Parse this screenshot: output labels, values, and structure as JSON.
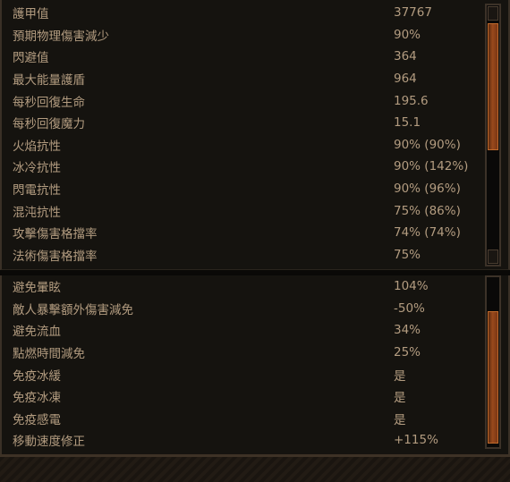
{
  "stats_top": [
    {
      "label": "護甲值",
      "value": "37767"
    },
    {
      "label": "預期物理傷害減少",
      "value": "90%"
    },
    {
      "label": "閃避值",
      "value": "364"
    },
    {
      "label": "最大能量護盾",
      "value": "964"
    },
    {
      "label": "每秒回復生命",
      "value": "195.6"
    },
    {
      "label": "每秒回復魔力",
      "value": "15.1"
    },
    {
      "label": "火焰抗性",
      "value": "90% (90%)"
    },
    {
      "label": "冰冷抗性",
      "value": "90% (142%)"
    },
    {
      "label": "閃電抗性",
      "value": "90% (96%)"
    },
    {
      "label": "混沌抗性",
      "value": "75% (86%)"
    },
    {
      "label": "攻擊傷害格擋率",
      "value": "74% (74%)"
    },
    {
      "label": "法術傷害格擋率",
      "value": "75%"
    }
  ],
  "stats_bottom": [
    {
      "label": "避免暈眩",
      "value": "104%"
    },
    {
      "label": "敵人暴擊額外傷害減免",
      "value": "-50%"
    },
    {
      "label": "避免流血",
      "value": "34%"
    },
    {
      "label": "點燃時間減免",
      "value": "25%"
    },
    {
      "label": "免疫冰緩",
      "value": "是"
    },
    {
      "label": "免疫冰凍",
      "value": "是"
    },
    {
      "label": "免疫感電",
      "value": "是"
    },
    {
      "label": "移動速度修正",
      "value": "+115%"
    }
  ]
}
